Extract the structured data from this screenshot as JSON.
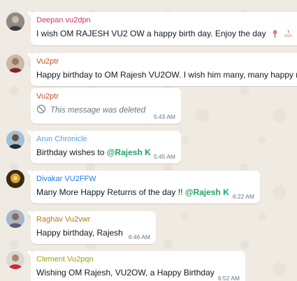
{
  "messages": [
    {
      "sender": "Deepan vu2dpn",
      "sender_color": "#d3396d",
      "text": "I wish OM RAJESH VU2 OW  a happy birth day. Enjoy the day",
      "time": ""
    },
    {
      "sender": "Vu2ptr",
      "sender_color": "#c4532d",
      "text": "Happy birthday to OM Rajesh VU2OW. I wish him many, many happy r",
      "time": ""
    },
    {
      "sender": "Vu2ptr",
      "sender_color": "#c4532d",
      "text": "This message was deleted",
      "time": "5:43 AM"
    },
    {
      "sender": "Arun Chronicle",
      "sender_color": "#5f9fd6",
      "text": "Birthday wishes to ",
      "mention": "@Rajesh K",
      "time": "5:45 AM"
    },
    {
      "sender": "Divakar VU2FFW",
      "sender_color": "#1f7aec",
      "text": "Many More Happy Returns of the day !! ",
      "mention": "@Rajesh K",
      "time": "6:22 AM"
    },
    {
      "sender": "Raghav Vu2vwr",
      "sender_color": "#b07d13",
      "text": "Happy birthday, Rajesh",
      "time": "6:46 AM"
    },
    {
      "sender": "Clement Vu2pqn",
      "sender_color": "#a2a000",
      "text": "Wishing OM Rajesh, VU2OW, a Happy Birthday",
      "time": "6:52 AM"
    }
  ],
  "icons": {
    "emoji_1": "flower-emoji",
    "emoji_2": "cake-emoji",
    "emoji_3": "flower-emoji",
    "deleted": "deleted-icon"
  }
}
